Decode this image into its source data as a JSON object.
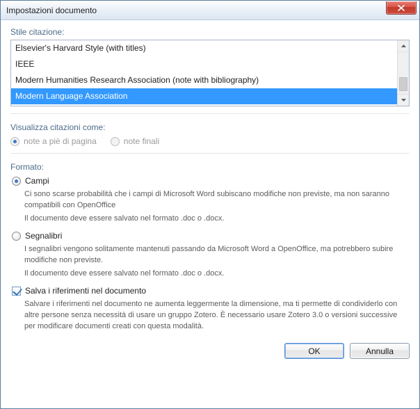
{
  "window": {
    "title": "Impostazioni documento"
  },
  "citation_style": {
    "label": "Stile citazione:",
    "items": [
      "Elsevier's Harvard Style (with titles)",
      "IEEE",
      "Modern Humanities Research Association (note with bibliography)",
      "Modern Language Association"
    ],
    "selected_index": 3
  },
  "display_citations": {
    "label": "Visualizza citazioni come:",
    "footnotes": "note a piè di pagina",
    "endnotes": "note finali",
    "enabled": false
  },
  "format": {
    "label": "Formato:",
    "fields": {
      "label": "Campi",
      "desc1": "Ci sono scarse probabilità che i campi di Microsoft Word subiscano modifiche non previste, ma non saranno compatibili con OpenOffice",
      "desc2": "Il documento deve essere salvato nel formato .doc o .docx.",
      "checked": true
    },
    "bookmarks": {
      "label": "Segnalibri",
      "desc1": "I segnalibri vengono solitamente mantenuti passando da Microsoft Word a OpenOffice, ma potrebbero subire modifiche non previste.",
      "desc2": "Il documento deve essere salvato nel formato .doc o .docx.",
      "checked": false
    },
    "save_refs": {
      "label": "Salva i riferimenti nel documento",
      "desc": "Salvare i riferimenti nel documento ne aumenta leggermente la dimensione, ma ti permette di condividerlo con altre persone senza necessità di usare un gruppo Zotero. È necessario usare Zotero 3.0 o versioni successive per modificare documenti creati con questa modalità.",
      "checked": true
    }
  },
  "buttons": {
    "ok": "OK",
    "cancel": "Annulla"
  }
}
